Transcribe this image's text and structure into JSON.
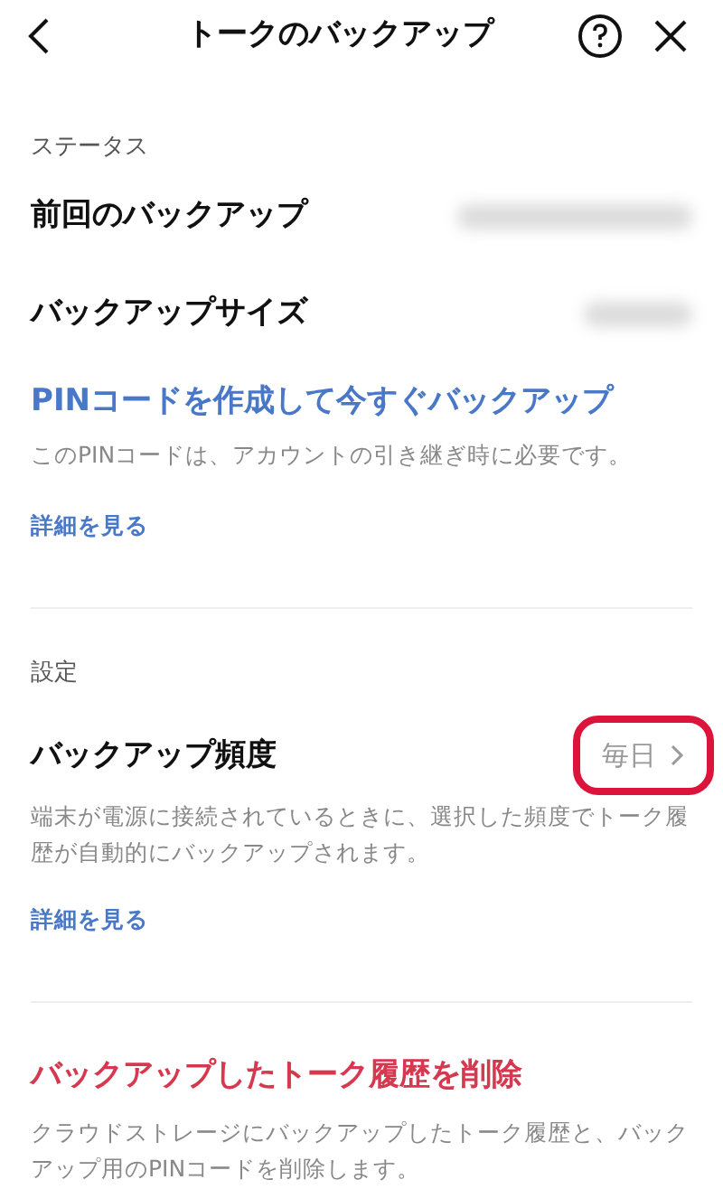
{
  "header": {
    "title": "トークのバックアップ"
  },
  "status_section": {
    "heading": "ステータス",
    "rows": [
      {
        "label": "前回のバックアップ",
        "value_hidden": true
      },
      {
        "label": "バックアップサイズ",
        "value_hidden": true
      }
    ],
    "action": "PINコードを作成して今すぐバックアップ",
    "description": "このPINコードは、アカウントの引き継ぎ時に必要です。",
    "more_link": "詳細を見る"
  },
  "settings_section": {
    "heading": "設定",
    "frequency": {
      "label": "バックアップ頻度",
      "value": "毎日",
      "highlighted": true
    },
    "description": "端末が電源に接続されているときに、選択した頻度でトーク履歴が自動的にバックアップされます。",
    "more_link": "詳細を見る"
  },
  "delete_section": {
    "action": "バックアップしたトーク履歴を削除",
    "description": "クラウドストレージにバックアップしたトーク履歴と、バックアップ用のPINコードを削除します。"
  }
}
